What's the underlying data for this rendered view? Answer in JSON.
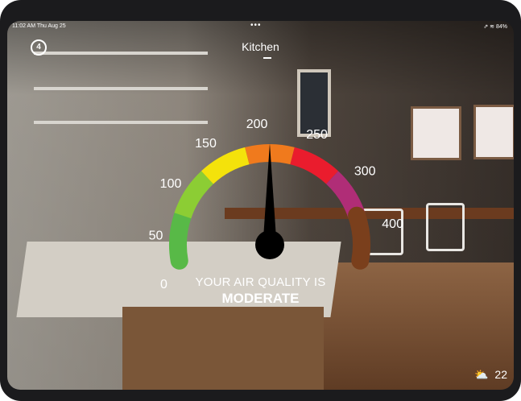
{
  "status_bar": {
    "time": "11:02 AM  Thu Aug 25",
    "dots": "•••",
    "right": "⇗ ≋ 84%"
  },
  "room": {
    "name": "Kitchen"
  },
  "logo": {
    "glyph": "4"
  },
  "gauge": {
    "ticks": [
      "0",
      "50",
      "100",
      "150",
      "200",
      "250",
      "300",
      "400"
    ],
    "value_state": "MODERATE",
    "colors": [
      "#58b947",
      "#8ccd34",
      "#f4e20b",
      "#f07a1d",
      "#ea1c2d",
      "#b02d77",
      "#7a3f1c"
    ]
  },
  "aq": {
    "caption": "YOUR AIR QUALITY IS",
    "level": "MODERATE"
  },
  "weather": {
    "icon": "partly-cloudy-sun-icon",
    "temp": "22"
  }
}
